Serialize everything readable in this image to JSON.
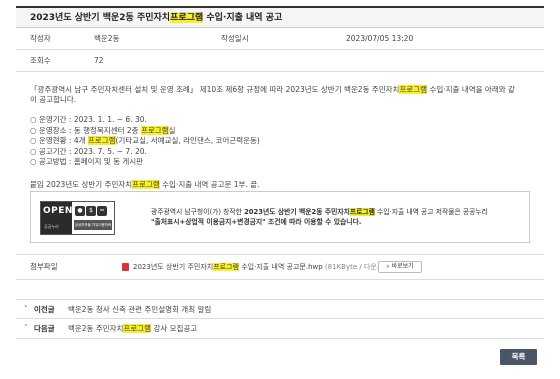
{
  "header": {
    "title_before": "2023년도 상반기 백운2동 주민자치",
    "title_highlight": "프로그램",
    "title_after": " 수입·지출 내역 공고"
  },
  "meta": {
    "author_label": "작성자",
    "author_value": "백운2동",
    "date_label": "작성일시",
    "date_value": "2023/07/05 13:20",
    "views_label": "조회수",
    "views_value": "72"
  },
  "body": {
    "intro_1": "「광주광역시 남구 주민자치센터 설치 및 운영 조례」 제10조 제6항 규정에 따라 2023년도 상반기 백운2동 주민자치",
    "intro_hl": "프로그램",
    "intro_2": " 수입·지출 내역을 아래와 같",
    "intro_3": "이 공고합니다.",
    "items": [
      {
        "before": "○ 운영기간 : 2023. 1. 1. ~ 6. 30.",
        "hl": "",
        "after": ""
      },
      {
        "before": "○ 운영장소 : 동 행정복지센터 2층 ",
        "hl": "프로그램",
        "after": "실"
      },
      {
        "before": "○ 운영현황 : 4개 ",
        "hl": "프로그램",
        "after": "(기타교실, 서예교실, 라인댄스, 코어근력운동)"
      },
      {
        "before": "○ 공고기간 : 2023. 7. 5. ~ 7. 20.",
        "hl": "",
        "after": ""
      },
      {
        "before": "○ 공고방법 : 홈페이지 및 동 게시판",
        "hl": "",
        "after": ""
      }
    ],
    "attach_before": "붙임  2023년도 상반기 주민자치",
    "attach_hl": "프로그램",
    "attach_after": " 수입·지출 내역 공고문 1부.  끝."
  },
  "license": {
    "logo_text": "OPEN",
    "logo_sub": "공공누리",
    "logo_type": "공공저작물 자유이용허락",
    "line1_before": "광주광역시 남구청이(가) 창작한 ",
    "line1_bold": "2023년도 상반기 백운2동 주민자치",
    "line1_hl": "프로그램",
    "line1_after": " 수입·지출 내역 공고 저작물은 공공누리",
    "line2": "\"출처표시+상업적 이용금지+변경금지\" 조건에 따라 이용할 수 있습니다."
  },
  "attachment": {
    "label": "첨부파일",
    "name_before": "2023년도 상반기 주민자치",
    "name_hl": "프로그램",
    "name_after": " 수입·지출 내역 공고문.hwp",
    "meta": " (81KByte / 다운로드:10)",
    "preview_label": "바로보기"
  },
  "navigation": {
    "prev_label": "이전글",
    "prev_title": "백운2동 청사 신축 관련 주민설명회 개최 알림",
    "next_label": "다음글",
    "next_title_before": "백운2동 주민자치",
    "next_title_hl": "프로그램",
    "next_title_after": " 강사 모집공고"
  },
  "list_button": "목록",
  "colors": {
    "highlight": "#f7f028",
    "list_button": "#4a5566"
  }
}
